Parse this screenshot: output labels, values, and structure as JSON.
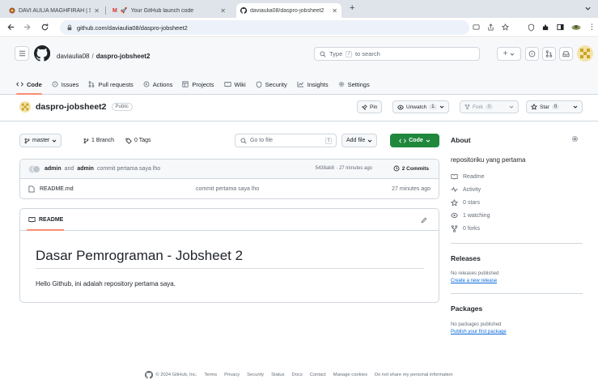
{
  "browser": {
    "tabs": [
      {
        "label": "DAVI AULIA MAGHFIRAH | Sp",
        "active": false
      },
      {
        "label": "Your GitHub launch code",
        "active": false
      },
      {
        "label": "daviaulia08/daspro-jobsheet2",
        "active": true
      }
    ],
    "new_tab": "+",
    "url": "github.com/daviaulia08/daspro-jobsheet2"
  },
  "header": {
    "owner": "daviaulia08",
    "separator": "/",
    "repo": "daspro-jobsheet2",
    "search_prefix": "Type",
    "search_key": "/",
    "search_suffix": "to search",
    "plus": "+"
  },
  "nav": [
    {
      "label": "Code",
      "icon": "code-icon",
      "active": true
    },
    {
      "label": "Issues",
      "icon": "issue-icon"
    },
    {
      "label": "Pull requests",
      "icon": "pull-request-icon"
    },
    {
      "label": "Actions",
      "icon": "play-icon"
    },
    {
      "label": "Projects",
      "icon": "table-icon"
    },
    {
      "label": "Wiki",
      "icon": "book-icon"
    },
    {
      "label": "Security",
      "icon": "shield-icon"
    },
    {
      "label": "Insights",
      "icon": "graph-icon"
    },
    {
      "label": "Settings",
      "icon": "gear-icon"
    }
  ],
  "repo": {
    "name": "daspro-jobsheet2",
    "visibility": "Public",
    "pin": "Pin",
    "unwatch": "Unwatch",
    "unwatch_count": "1",
    "fork": "Fork",
    "fork_count": "0",
    "star": "Star",
    "star_count": "0"
  },
  "branch": {
    "name": "master",
    "branches": "1 Branch",
    "tags": "0 Tags",
    "goto_placeholder": "Go to file",
    "goto_key": "t",
    "add_file": "Add file",
    "code": "Code"
  },
  "commit": {
    "author1": "admin",
    "and": "and",
    "author2": "admin",
    "message": "commit pertama saya lho",
    "hash": "5438ab8",
    "dot": "·",
    "time": "27 minutes ago",
    "commits": "2 Commits"
  },
  "files": [
    {
      "name": "README.md",
      "message": "commit pertama saya lho",
      "time": "27 minutes ago"
    }
  ],
  "readme": {
    "tab": "README",
    "title": "Dasar Pemrograman - Jobsheet 2",
    "body": "Hello Github, ini adalah repository pertama saya."
  },
  "about": {
    "heading": "About",
    "description": "repositoriku yang pertama",
    "items": [
      {
        "label": "Readme",
        "icon": "book-icon"
      },
      {
        "label": "Activity",
        "icon": "pulse-icon"
      },
      {
        "label": "0 stars",
        "icon": "star-icon"
      },
      {
        "label": "1 watching",
        "icon": "eye-icon"
      },
      {
        "label": "0 forks",
        "icon": "fork-icon"
      }
    ]
  },
  "releases": {
    "heading": "Releases",
    "none": "No releases published",
    "create": "Create a new release"
  },
  "packages": {
    "heading": "Packages",
    "none": "No packages published",
    "publish": "Publish your first package"
  },
  "footer": {
    "copyright": "© 2024 GitHub, Inc.",
    "links": [
      "Terms",
      "Privacy",
      "Security",
      "Status",
      "Docs",
      "Contact",
      "Manage cookies",
      "Do not share my personal information"
    ]
  },
  "colors": {
    "green": "#1f883d",
    "link": "#0969da",
    "accent_underline": "#fd8c73"
  }
}
